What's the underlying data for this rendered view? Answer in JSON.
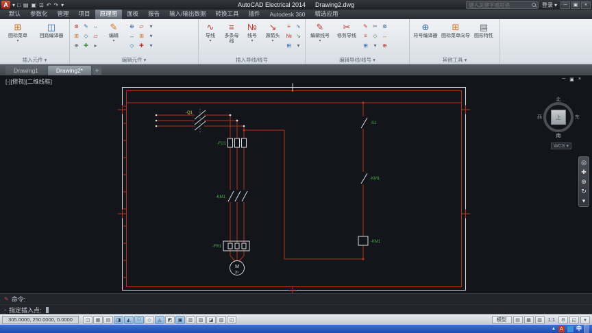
{
  "icons": {
    "app_logo": "A",
    "dropdown": "▾",
    "new": "□",
    "open": "▤",
    "save": "▣",
    "plot": "⊡",
    "undo": "↶",
    "redo": "↷",
    "min": "─",
    "restore": "▣",
    "close": "×",
    "icon_menu": "⊞",
    "circuit_builder": "◫",
    "edit": "✎",
    "wire": "∿",
    "multi_bus": "≡",
    "wire_number": "№",
    "source_arrow": "↘",
    "edit_wire_number": "✎",
    "trim_wire": "✂",
    "symbol_builder": "⊕",
    "icon_menu_wizard": "⊞",
    "drawing_properties": "▤",
    "edit_tools": [
      "⊗",
      "✎",
      "↔",
      "⊞",
      "◇",
      "▱",
      "⊕",
      "✚",
      "▸"
    ],
    "edit_tools2": [
      "⊕",
      "▱",
      "▾",
      "↔",
      "⊞",
      "▾",
      "◇",
      "✚",
      "▾"
    ],
    "wire_tools": [
      "≡",
      "∿",
      "№",
      "↘",
      "⊞",
      "▾"
    ],
    "editwire_tools": [
      "✎",
      "✂",
      "⊗",
      "≡",
      "◇",
      "↔",
      "⊞",
      "▾",
      "⊕"
    ],
    "toggles": [
      "◫",
      "▦",
      "▤",
      "◨",
      "◭",
      "□",
      "◇",
      "◬",
      "◩",
      "▣",
      "▥",
      "▨",
      "◪",
      "▧",
      "◰"
    ],
    "sb_right": [
      "▤",
      "▦",
      "▧",
      "⚙",
      "◱",
      "▾"
    ],
    "nav": [
      "◎",
      "✚",
      "⊕",
      "↻",
      "▾"
    ],
    "cmd_tool": "✎",
    "prompt_marker": "-",
    "tray_arrow": "▲",
    "vp_min": "─",
    "vp_restore": "▣",
    "vp_close": "×"
  },
  "colors": {
    "wire_red": "#b5321f",
    "geometry_white": "#d9dde1",
    "label_green": "#44b04a",
    "label_yellow": "#cfcf3a",
    "canvas_bg": "#13151a",
    "taskbar_blue": "#2a5bc8"
  },
  "titlebar": {
    "app_title": "AutoCAD Electrical 2014",
    "doc_title": "Drawing2.dwg",
    "search_placeholder": "键入关键字或短语",
    "signin": "登录"
  },
  "ribbon_tabs": {
    "items": [
      "默认",
      "参数化",
      "管理",
      "项目",
      "原理图",
      "面板",
      "报告",
      "输入/输出数据",
      "转换工具",
      "插件",
      "Autodesk 360",
      "精选应用"
    ],
    "active": "原理图"
  },
  "ribbon": {
    "panels": {
      "insert_components": {
        "title": "插入元件",
        "buttons": {
          "icon_menu": "图标菜单",
          "circuit_builder": "回路编译器"
        }
      },
      "edit_components": {
        "title": "编辑元件",
        "buttons": {
          "edit": "编辑"
        }
      },
      "insert_wires": {
        "title": "插入导线/线号",
        "buttons": {
          "wire": "导线",
          "multi_bus": "多条母线",
          "wire_number": "线号",
          "source_arrow": "源箭头"
        }
      },
      "edit_wires": {
        "title": "编辑导线/线号",
        "buttons": {
          "edit_wire_number": "编辑线号",
          "trim_wire": "修剪导线"
        }
      },
      "other_tools": {
        "title": "其他工具",
        "buttons": {
          "symbol_builder": "符号编译器",
          "icon_menu_wizard": "图标菜单向导",
          "drawing_properties": "图形特性"
        }
      }
    }
  },
  "doc_tabs": {
    "tab1": "Drawing1",
    "tab2": "Drawing2*",
    "new_tab": "+"
  },
  "canvas": {
    "viewport_controls": "[-][俯视][二维线框]",
    "viewcube": {
      "north": "北",
      "south": "南",
      "west": "西",
      "east": "东",
      "top": "上",
      "wcs": "WCS"
    },
    "schematic_labels": {
      "disconnect": "-Q1",
      "fuse": "-FU1",
      "contactor_main": "-KM1",
      "overload": "-FR1",
      "motor": "M",
      "motor_phase": "3~",
      "stop_contact": "-S1",
      "aux_contact": "-KM1",
      "coil": "-KM1"
    }
  },
  "command_line": {
    "history": "命令:",
    "prompt": "指定插入点:"
  },
  "status_bar": {
    "coordinates": "305.0000, 250.0000, 0.0000",
    "model": "模型",
    "scale": "1:1"
  },
  "taskbar": {
    "ime": "中"
  }
}
